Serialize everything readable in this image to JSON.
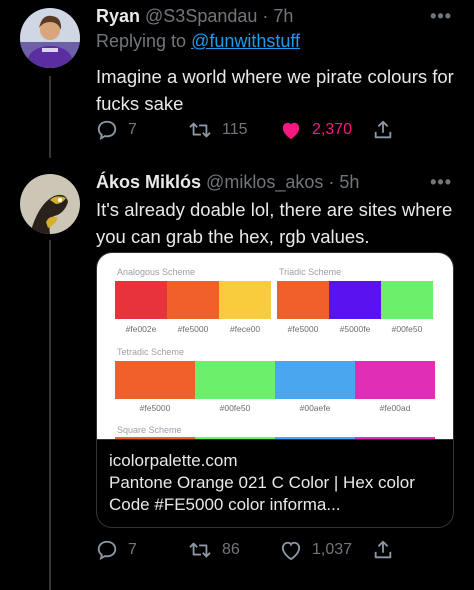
{
  "tweet1": {
    "name": "Ryan",
    "handle": "@S3Spandau",
    "separator": "·",
    "time": "7h",
    "more": "•••",
    "replying_prefix": "Replying to ",
    "replying_handle": "@funwithstuff",
    "text": "Imagine a world where we pirate colours for fucks sake",
    "actions": {
      "reply": {
        "icon": "reply-icon",
        "count": "7"
      },
      "retweet": {
        "icon": "retweet-icon",
        "count": "115"
      },
      "like": {
        "icon": "heart-icon",
        "count": "2,370",
        "liked": true,
        "color": "#f91880"
      },
      "share": {
        "icon": "share-icon"
      }
    }
  },
  "tweet2": {
    "name": "Ákos Miklós",
    "handle": "@miklos_akos",
    "separator": "·",
    "time": "5h",
    "more": "•••",
    "text": "It's already doable lol, there are sites where you can grab the hex, rgb values.",
    "card": {
      "domain": "icolorpalette.com",
      "title": "Pantone Orange 021 C Color | Hex color Code #FE5000 color informa...",
      "schemes": [
        {
          "title": "Analogous Scheme",
          "swatches": [
            {
              "hex": "#fe002e",
              "color": "#e8333d"
            },
            {
              "hex": "#fe5000",
              "color": "#f0602a"
            },
            {
              "hex": "#fece00",
              "color": "#f8cc3c"
            }
          ]
        },
        {
          "title": "Triadic Scheme",
          "swatches": [
            {
              "hex": "#fe5000",
              "color": "#f0602a"
            },
            {
              "hex": "#5000fe",
              "color": "#5a12f0"
            },
            {
              "hex": "#00fe50",
              "color": "#6cf06c"
            }
          ]
        },
        {
          "title": "Tetradic Scheme",
          "swatches": [
            {
              "hex": "#fe5000",
              "color": "#f0602a"
            },
            {
              "hex": "#00fe50",
              "color": "#6cf06c"
            },
            {
              "hex": "#00aefe",
              "color": "#4aa6ee"
            },
            {
              "hex": "#fe00ad",
              "color": "#e02fb6"
            }
          ]
        },
        {
          "title": "Square Scheme",
          "swatches": [
            {
              "color": "#f0602a"
            },
            {
              "color": "#6cf06c"
            },
            {
              "color": "#4aa6ee"
            },
            {
              "color": "#e02fb6"
            }
          ]
        }
      ]
    },
    "actions": {
      "reply": {
        "icon": "reply-icon",
        "count": "7"
      },
      "retweet": {
        "icon": "retweet-icon",
        "count": "86"
      },
      "like": {
        "icon": "heart-icon",
        "count": "1,037"
      },
      "share": {
        "icon": "share-icon"
      }
    }
  }
}
